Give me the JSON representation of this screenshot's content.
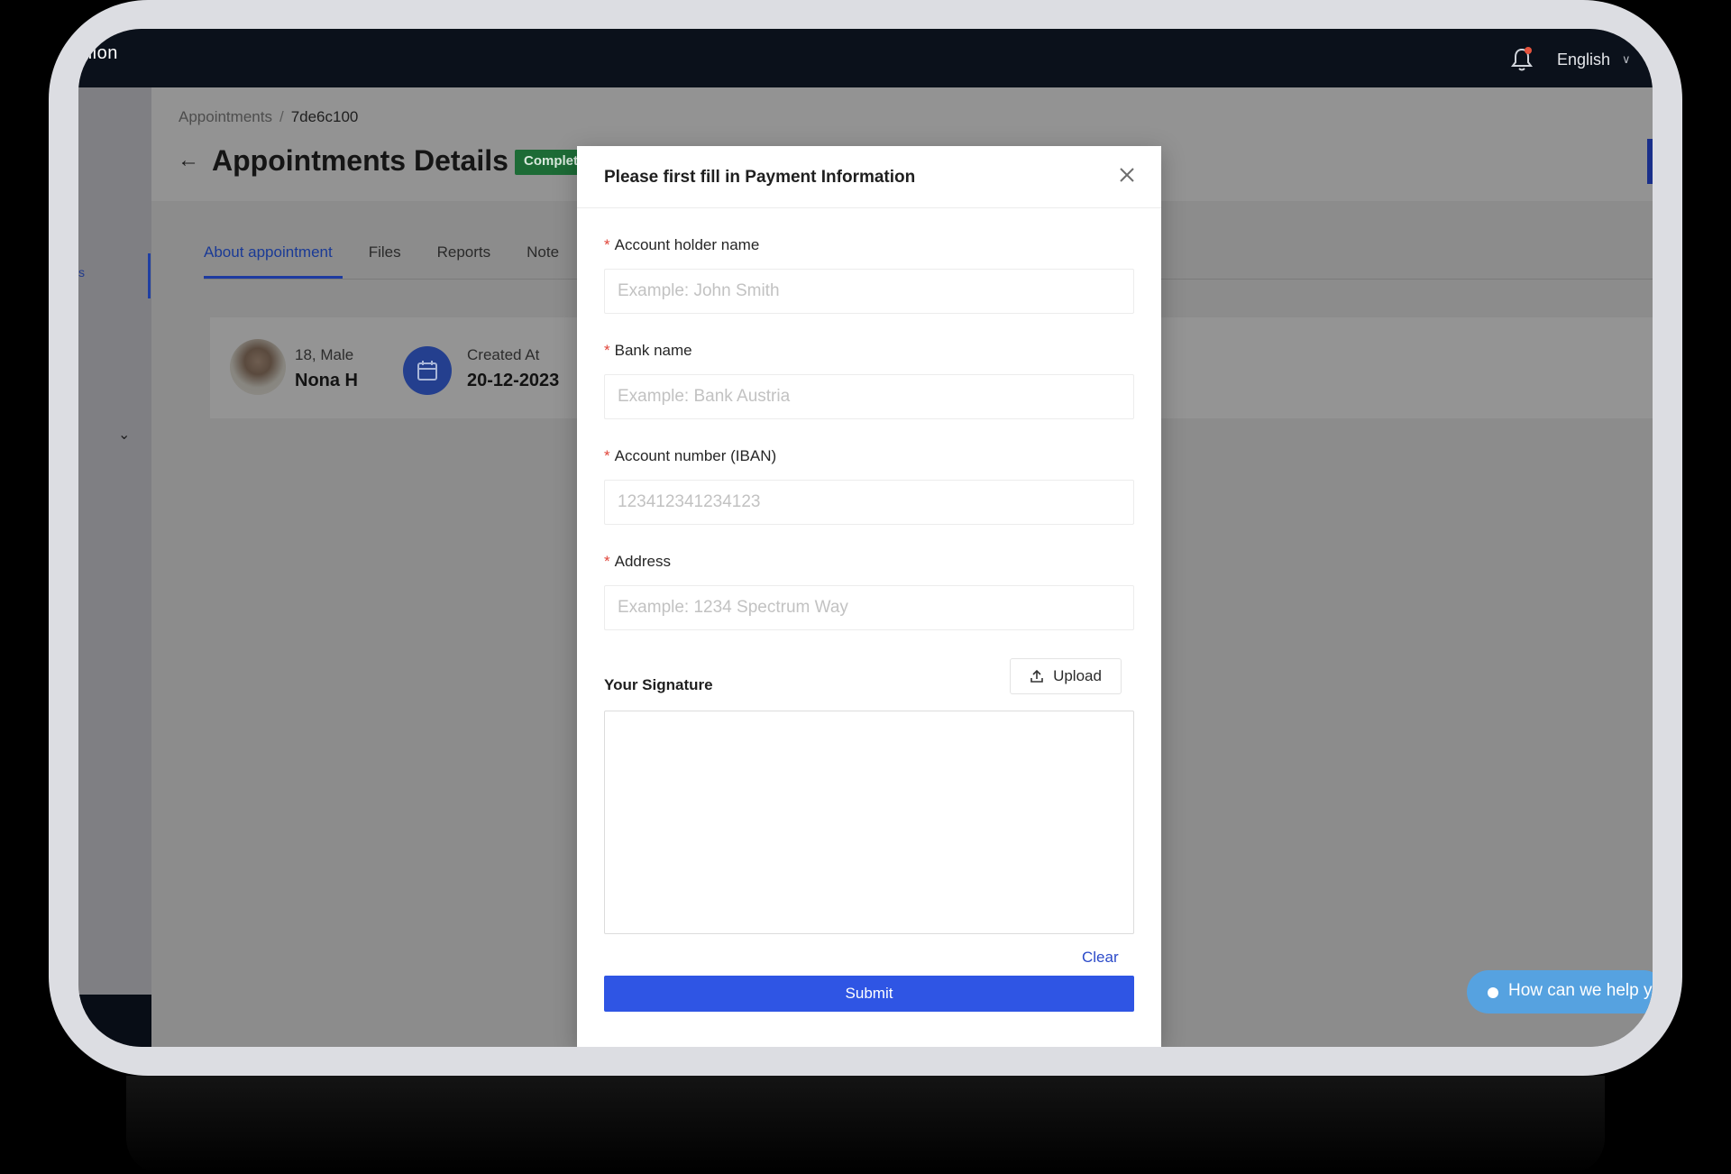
{
  "app": {
    "brand": "nion",
    "language": "English"
  },
  "breadcrumb": {
    "parent": "Appointments",
    "separator": "/",
    "current": "7de6c100"
  },
  "page": {
    "title": "Appointments Details",
    "status": "Complet"
  },
  "tabs": [
    {
      "label": "About appointment",
      "active": true
    },
    {
      "label": "Files",
      "active": false
    },
    {
      "label": "Reports",
      "active": false
    },
    {
      "label": "Note",
      "active": false
    }
  ],
  "patient": {
    "meta": "18, Male",
    "name": "Nona H"
  },
  "created": {
    "label": "Created At",
    "value": "20-12-2023"
  },
  "help": {
    "text": "How can we help y"
  },
  "modal": {
    "title": "Please first fill in Payment Information",
    "fields": [
      {
        "label": "Account holder name",
        "placeholder": "Example: John Smith",
        "value": ""
      },
      {
        "label": "Bank name",
        "placeholder": "Example: Bank Austria",
        "value": ""
      },
      {
        "label": "Account number (IBAN)",
        "placeholder": "123412341234123",
        "value": ""
      },
      {
        "label": "Address",
        "placeholder": "Example: 1234 Spectrum Way",
        "value": ""
      }
    ],
    "required_mark": "*",
    "signature_label": "Your Signature",
    "upload_label": "Upload",
    "clear_label": "Clear",
    "submit_label": "Submit"
  },
  "colors": {
    "accent": "#2f55e4",
    "link": "#2b4ac9",
    "required": "#e0453a",
    "topbar": "#0b111b",
    "status_badge": "#1d6b36",
    "help_pill": "#56a2e0"
  }
}
